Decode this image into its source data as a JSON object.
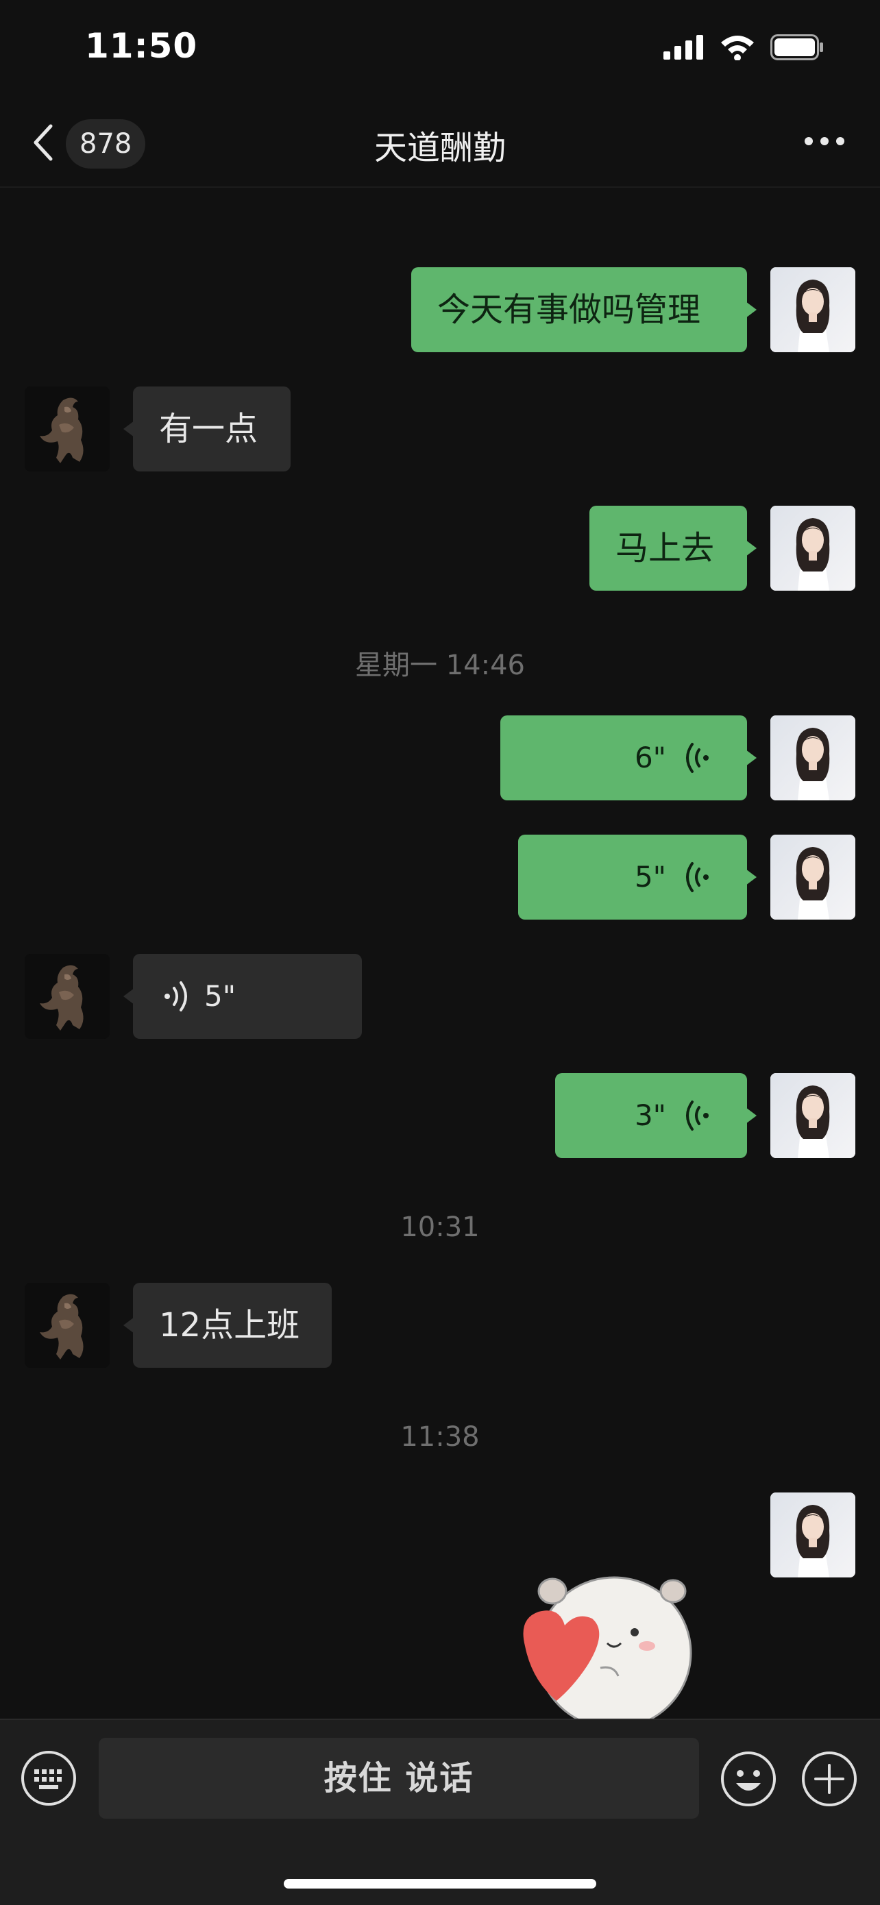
{
  "status_bar": {
    "time": "11:50"
  },
  "nav": {
    "unread_count": "878",
    "title": "天道酬勤",
    "icons": [
      "chevron-left-icon",
      "more-icon"
    ]
  },
  "messages": [
    {
      "dir": "out",
      "type": "text",
      "text": "今天有事做吗管理"
    },
    {
      "dir": "in",
      "type": "text",
      "text": "有一点"
    },
    {
      "dir": "out",
      "type": "text",
      "text": "马上去"
    },
    {
      "type": "time",
      "text": "星期一 14:46"
    },
    {
      "dir": "out",
      "type": "voice",
      "duration": "6\""
    },
    {
      "dir": "out",
      "type": "voice",
      "duration": "5\""
    },
    {
      "dir": "in",
      "type": "voice",
      "duration": "5\""
    },
    {
      "dir": "out",
      "type": "voice",
      "duration": "3\""
    },
    {
      "type": "time",
      "text": "10:31"
    },
    {
      "dir": "in",
      "type": "text",
      "text": "12点上班"
    },
    {
      "type": "time",
      "text": "11:38"
    },
    {
      "dir": "out",
      "type": "sticker",
      "sticker": "hamster-heart-sticker"
    }
  ],
  "input_bar": {
    "hold_to_talk_label": "按住 说话",
    "icons": [
      "keyboard-icon",
      "emoji-icon",
      "plus-icon"
    ]
  },
  "colors": {
    "background": "#111111",
    "outgoing_bubble": "#5fb66d",
    "incoming_bubble": "#2c2c2c",
    "input_bar": "#1e1e1e"
  }
}
